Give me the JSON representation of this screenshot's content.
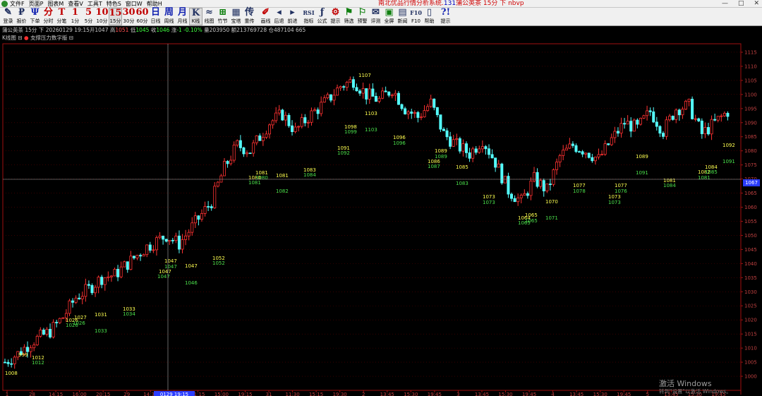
{
  "window": {
    "menus": [
      "文件F",
      "页面P",
      "图表M",
      "查看V",
      "工具T",
      "特色S",
      "窗口W",
      "帮助H"
    ],
    "title_prefix": "南北优品行情分析系统.",
    "title_code": "131",
    "title_suffix": "蒲公英茶 15分 下 nbvp",
    "controls": [
      "—",
      "□",
      "✕"
    ]
  },
  "toolbar": [
    {
      "glyph": "✎",
      "label": "登录",
      "color": "dark"
    },
    {
      "glyph": "₽",
      "label": "报价",
      "color": "dark"
    },
    {
      "glyph": "Ψ",
      "label": "下单",
      "color": "blue"
    },
    {
      "glyph": "分",
      "label": "分时",
      "color": "red"
    },
    {
      "glyph": "T",
      "label": "分笔",
      "color": "red"
    },
    {
      "glyph": "1",
      "label": "1分",
      "color": "red"
    },
    {
      "glyph": "5",
      "label": "5分",
      "color": "red"
    },
    {
      "glyph": "10",
      "label": "10分",
      "color": "red"
    },
    {
      "glyph": "15",
      "label": "15分",
      "color": "red",
      "selected": true
    },
    {
      "glyph": "30",
      "label": "30分",
      "color": "red"
    },
    {
      "glyph": "60",
      "label": "60分",
      "color": "red"
    },
    {
      "glyph": "日",
      "label": "日线",
      "color": "blue"
    },
    {
      "glyph": "周",
      "label": "周线",
      "color": "blue"
    },
    {
      "glyph": "月",
      "label": "月线",
      "color": "blue"
    },
    {
      "glyph": "K",
      "label": "K线",
      "color": "dark",
      "selected": true
    },
    {
      "glyph": "≈",
      "label": "线图",
      "color": "dark"
    },
    {
      "glyph": "⊞",
      "label": "竹节",
      "color": "green"
    },
    {
      "glyph": "▦",
      "label": "宝塔",
      "color": "dark"
    },
    {
      "glyph": "传",
      "label": "重传",
      "color": "dark"
    },
    {
      "glyph": "✐",
      "label": "画线",
      "color": "red"
    },
    {
      "glyph": "◂",
      "label": "后退",
      "color": "dark"
    },
    {
      "glyph": "▸",
      "label": "前进",
      "color": "dark"
    },
    {
      "glyph": "RSI",
      "label": "指标",
      "color": "dark"
    },
    {
      "glyph": "ƒ",
      "label": "公式",
      "color": "dark"
    },
    {
      "glyph": "⚙",
      "label": "提示",
      "color": "red"
    },
    {
      "glyph": "⚑",
      "label": "筛选",
      "color": "green"
    },
    {
      "glyph": "⚐",
      "label": "预警",
      "color": "green"
    },
    {
      "glyph": "✉",
      "label": "评测",
      "color": "dark"
    },
    {
      "glyph": "▣",
      "label": "全屏",
      "color": "green"
    },
    {
      "glyph": "▤",
      "label": "新闻",
      "color": "dark"
    },
    {
      "glyph": "F10",
      "label": "F10",
      "color": "dark"
    },
    {
      "glyph": "▯",
      "label": "帮助",
      "color": "dark"
    },
    {
      "glyph": "?!",
      "label": "提示",
      "color": "blue"
    }
  ],
  "info": {
    "name": "蒲公英茶 15分 下",
    "datetime": "20260129 19:15",
    "open_label": "开",
    "open": "1047",
    "high_label": "高",
    "high": "1051",
    "low_label": "低",
    "low": "1045",
    "close_label": "收",
    "close": "1046",
    "change_label": "涨",
    "change": "-1 -0.10%",
    "volume_label": "量",
    "volume": "203950",
    "amount_label": "额",
    "amount": "213769728",
    "oi_label": "仓",
    "oi": "487104 665"
  },
  "subbar": {
    "chart_label": "K线图",
    "indicator_label": "支撑压力数字版"
  },
  "current_price": "1067",
  "cursor": {
    "time_label": "0129 19:15"
  },
  "watermark": {
    "line1": "激活 Windows",
    "line2": "转到\"设置\"以激活 Windows。"
  },
  "colors": {
    "up": "#ff3232",
    "down": "#54ffff",
    "grid": "#5a0000",
    "axis_text": "#c04040",
    "upper_label": "#ffff50",
    "lower_label": "#4be04b"
  },
  "chart_data": {
    "type": "candlestick",
    "ylim": [
      995,
      1118
    ],
    "y_ticks": [
      1000,
      1005,
      1010,
      1015,
      1020,
      1025,
      1030,
      1035,
      1040,
      1045,
      1050,
      1055,
      1060,
      1065,
      1070,
      1075,
      1080,
      1085,
      1090,
      1095,
      1100,
      1105,
      1110,
      1115
    ],
    "x_ticks": [
      "1",
      "28",
      "14:15",
      "16:00",
      "20:15",
      "29",
      "14:30",
      "18:45",
      "21:15",
      "15:00",
      "19:15",
      "31",
      "11:30",
      "15:15",
      "19:30",
      "2",
      "13:45",
      "15:30",
      "19:45",
      "3",
      "13:45",
      "15:30",
      "19:45",
      "4",
      "13:45",
      "15:30",
      "19:45",
      "5",
      "13:45",
      "15:30",
      "19:45"
    ],
    "anchors": [
      [
        0,
        1005
      ],
      [
        4,
        1008
      ],
      [
        8,
        1012
      ],
      [
        14,
        1016
      ],
      [
        18,
        1021
      ],
      [
        22,
        1028
      ],
      [
        26,
        1031
      ],
      [
        30,
        1035
      ],
      [
        34,
        1036
      ],
      [
        38,
        1040
      ],
      [
        44,
        1046
      ],
      [
        50,
        1050
      ],
      [
        54,
        1047
      ],
      [
        58,
        1053
      ],
      [
        64,
        1062
      ],
      [
        68,
        1074
      ],
      [
        72,
        1082
      ],
      [
        76,
        1080
      ],
      [
        82,
        1090
      ],
      [
        86,
        1093
      ],
      [
        90,
        1087
      ],
      [
        94,
        1092
      ],
      [
        100,
        1098
      ],
      [
        104,
        1103
      ],
      [
        108,
        1105
      ],
      [
        112,
        1100
      ],
      [
        116,
        1098
      ],
      [
        120,
        1102
      ],
      [
        124,
        1095
      ],
      [
        128,
        1092
      ],
      [
        132,
        1097
      ],
      [
        136,
        1086
      ],
      [
        140,
        1082
      ],
      [
        144,
        1079
      ],
      [
        148,
        1084
      ],
      [
        152,
        1076
      ],
      [
        156,
        1066
      ],
      [
        160,
        1062
      ],
      [
        164,
        1070
      ],
      [
        168,
        1066
      ],
      [
        172,
        1078
      ],
      [
        176,
        1082
      ],
      [
        180,
        1080
      ],
      [
        184,
        1077
      ],
      [
        188,
        1084
      ],
      [
        192,
        1090
      ],
      [
        196,
        1088
      ],
      [
        200,
        1094
      ],
      [
        204,
        1087
      ],
      [
        208,
        1095
      ],
      [
        212,
        1096
      ],
      [
        216,
        1086
      ],
      [
        220,
        1090
      ],
      [
        224,
        1094
      ]
    ],
    "annotations": {
      "upper": [
        [
          "999",
          26,
          505
        ],
        [
          "1012",
          45,
          509
        ],
        [
          "1027",
          105,
          452
        ],
        [
          "1026",
          93,
          456
        ],
        [
          "1031",
          134,
          448
        ],
        [
          "1033",
          174,
          440
        ],
        [
          "1047",
          233,
          372
        ],
        [
          "1047",
          225,
          387
        ],
        [
          "1047",
          262,
          379
        ],
        [
          "1052",
          301,
          368
        ],
        [
          "1081",
          362,
          247
        ],
        [
          "1080",
          352,
          254
        ],
        [
          "1081",
          391,
          251
        ],
        [
          "1083",
          430,
          243
        ],
        [
          "1091",
          478,
          212
        ],
        [
          "1098",
          488,
          182
        ],
        [
          "1103",
          517,
          163
        ],
        [
          "1107",
          508,
          109
        ],
        [
          "1096",
          557,
          197
        ],
        [
          "1089",
          616,
          216
        ],
        [
          "1086",
          606,
          231
        ],
        [
          "1085",
          646,
          239
        ],
        [
          "1073",
          684,
          281
        ],
        [
          "1064",
          734,
          311
        ],
        [
          "1065",
          744,
          307
        ],
        [
          "1070",
          773,
          288
        ],
        [
          "1077",
          812,
          265
        ],
        [
          "1077",
          871,
          265
        ],
        [
          "1073",
          862,
          281
        ],
        [
          "1089",
          901,
          224
        ],
        [
          "1081",
          940,
          258
        ],
        [
          "1082",
          989,
          246
        ],
        [
          "1084",
          999,
          239
        ],
        [
          "1092",
          1024,
          208
        ],
        [
          "1008",
          7,
          531
        ]
      ],
      "lower": [
        [
          "1012",
          45,
          516
        ],
        [
          "1026",
          103,
          460
        ],
        [
          "1026",
          93,
          463
        ],
        [
          "1033",
          134,
          471
        ],
        [
          "1034",
          174,
          447
        ],
        [
          "1047",
          233,
          380
        ],
        [
          "1047",
          223,
          394
        ],
        [
          "1046",
          262,
          403
        ],
        [
          "1052",
          301,
          375
        ],
        [
          "1081",
          352,
          261
        ],
        [
          "1080",
          362,
          254
        ],
        [
          "1082",
          391,
          273
        ],
        [
          "1084",
          430,
          250
        ],
        [
          "1092",
          478,
          219
        ],
        [
          "1099",
          488,
          189
        ],
        [
          "1103",
          517,
          186
        ],
        [
          "1096",
          557,
          205
        ],
        [
          "1089",
          616,
          224
        ],
        [
          "1087",
          606,
          238
        ],
        [
          "1083",
          646,
          262
        ],
        [
          "1073",
          684,
          289
        ],
        [
          "1065",
          734,
          318
        ],
        [
          "1065",
          744,
          315
        ],
        [
          "1071",
          773,
          311
        ],
        [
          "1078",
          812,
          273
        ],
        [
          "1076",
          871,
          273
        ],
        [
          "1073",
          862,
          289
        ],
        [
          "1091",
          901,
          247
        ],
        [
          "1084",
          940,
          265
        ],
        [
          "1081",
          989,
          254
        ],
        [
          "1085",
          999,
          246
        ],
        [
          "1091",
          1024,
          231
        ]
      ]
    }
  }
}
